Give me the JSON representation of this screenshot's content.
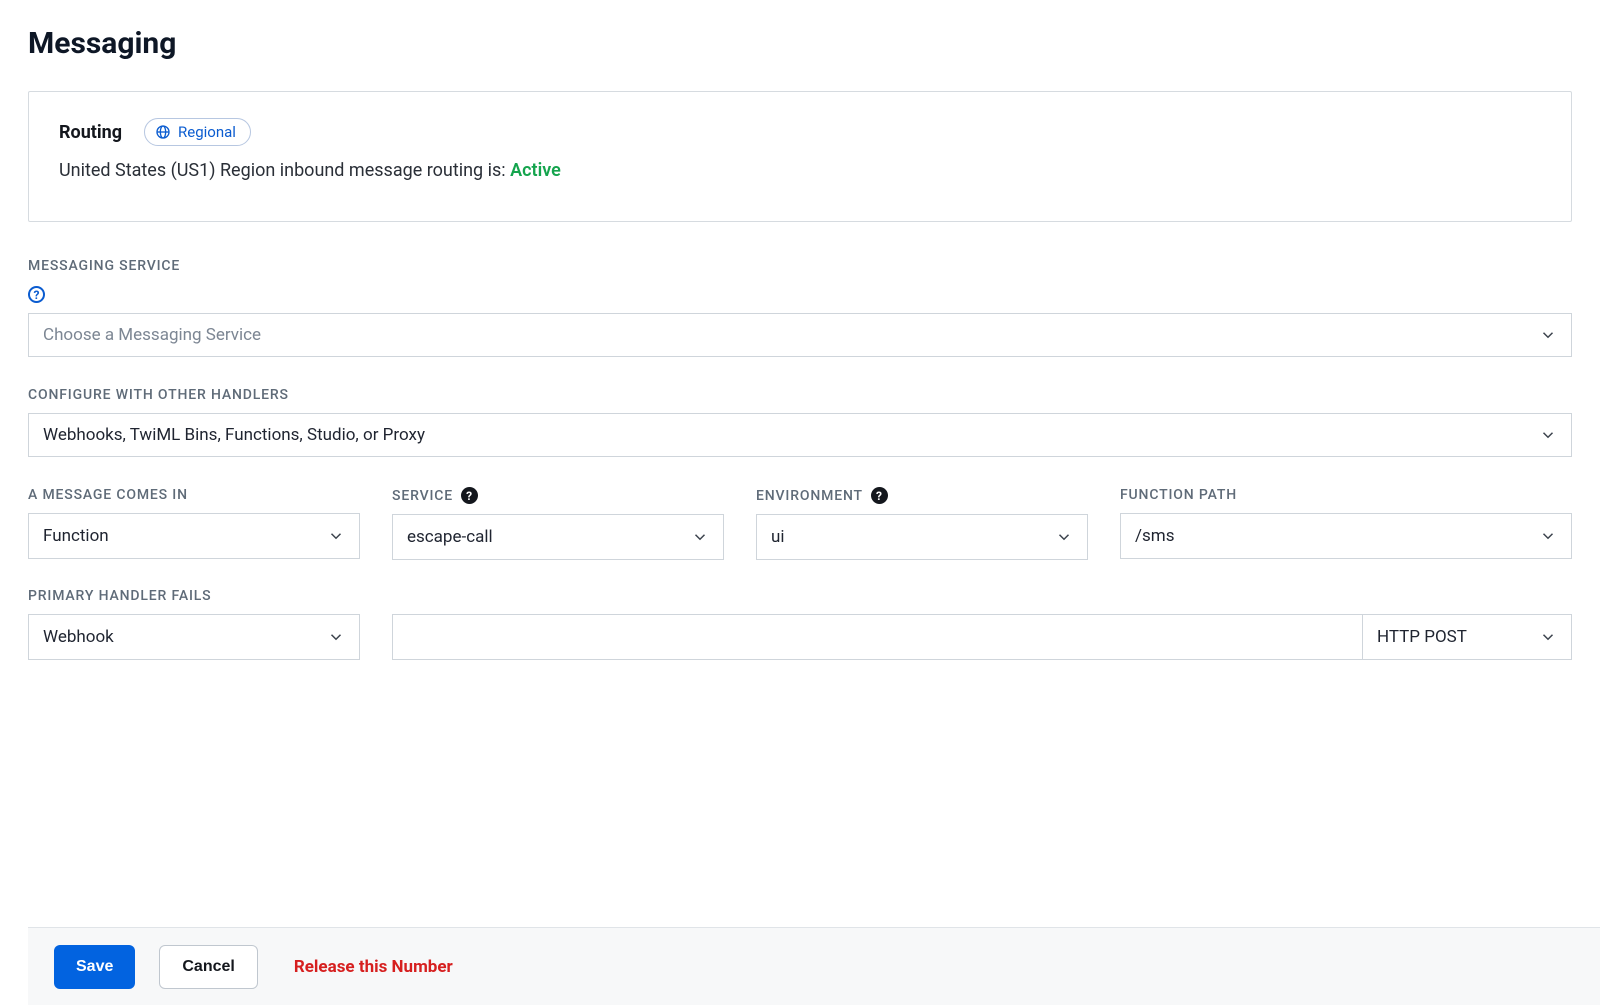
{
  "page": {
    "title": "Messaging"
  },
  "routing_panel": {
    "heading": "Routing",
    "badge_label": "Regional",
    "description_prefix": "United States (US1) Region inbound message routing is: ",
    "status": "Active"
  },
  "messaging_service": {
    "label": "MESSAGING SERVICE",
    "placeholder": "Choose a Messaging Service"
  },
  "config_handlers": {
    "label": "CONFIGURE WITH OTHER HANDLERS",
    "value": "Webhooks, TwiML Bins, Functions, Studio, or Proxy"
  },
  "incoming": {
    "message_comes_in": {
      "label": "A MESSAGE COMES IN",
      "value": "Function"
    },
    "service": {
      "label": "SERVICE",
      "value": "escape-call"
    },
    "environment": {
      "label": "ENVIRONMENT",
      "value": "ui"
    },
    "function_path": {
      "label": "FUNCTION PATH",
      "value": "/sms"
    }
  },
  "primary_fails": {
    "label": "PRIMARY HANDLER FAILS",
    "type_value": "Webhook",
    "url_value": "",
    "method_value": "HTTP POST"
  },
  "footer": {
    "save": "Save",
    "cancel": "Cancel",
    "release": "Release this Number"
  }
}
